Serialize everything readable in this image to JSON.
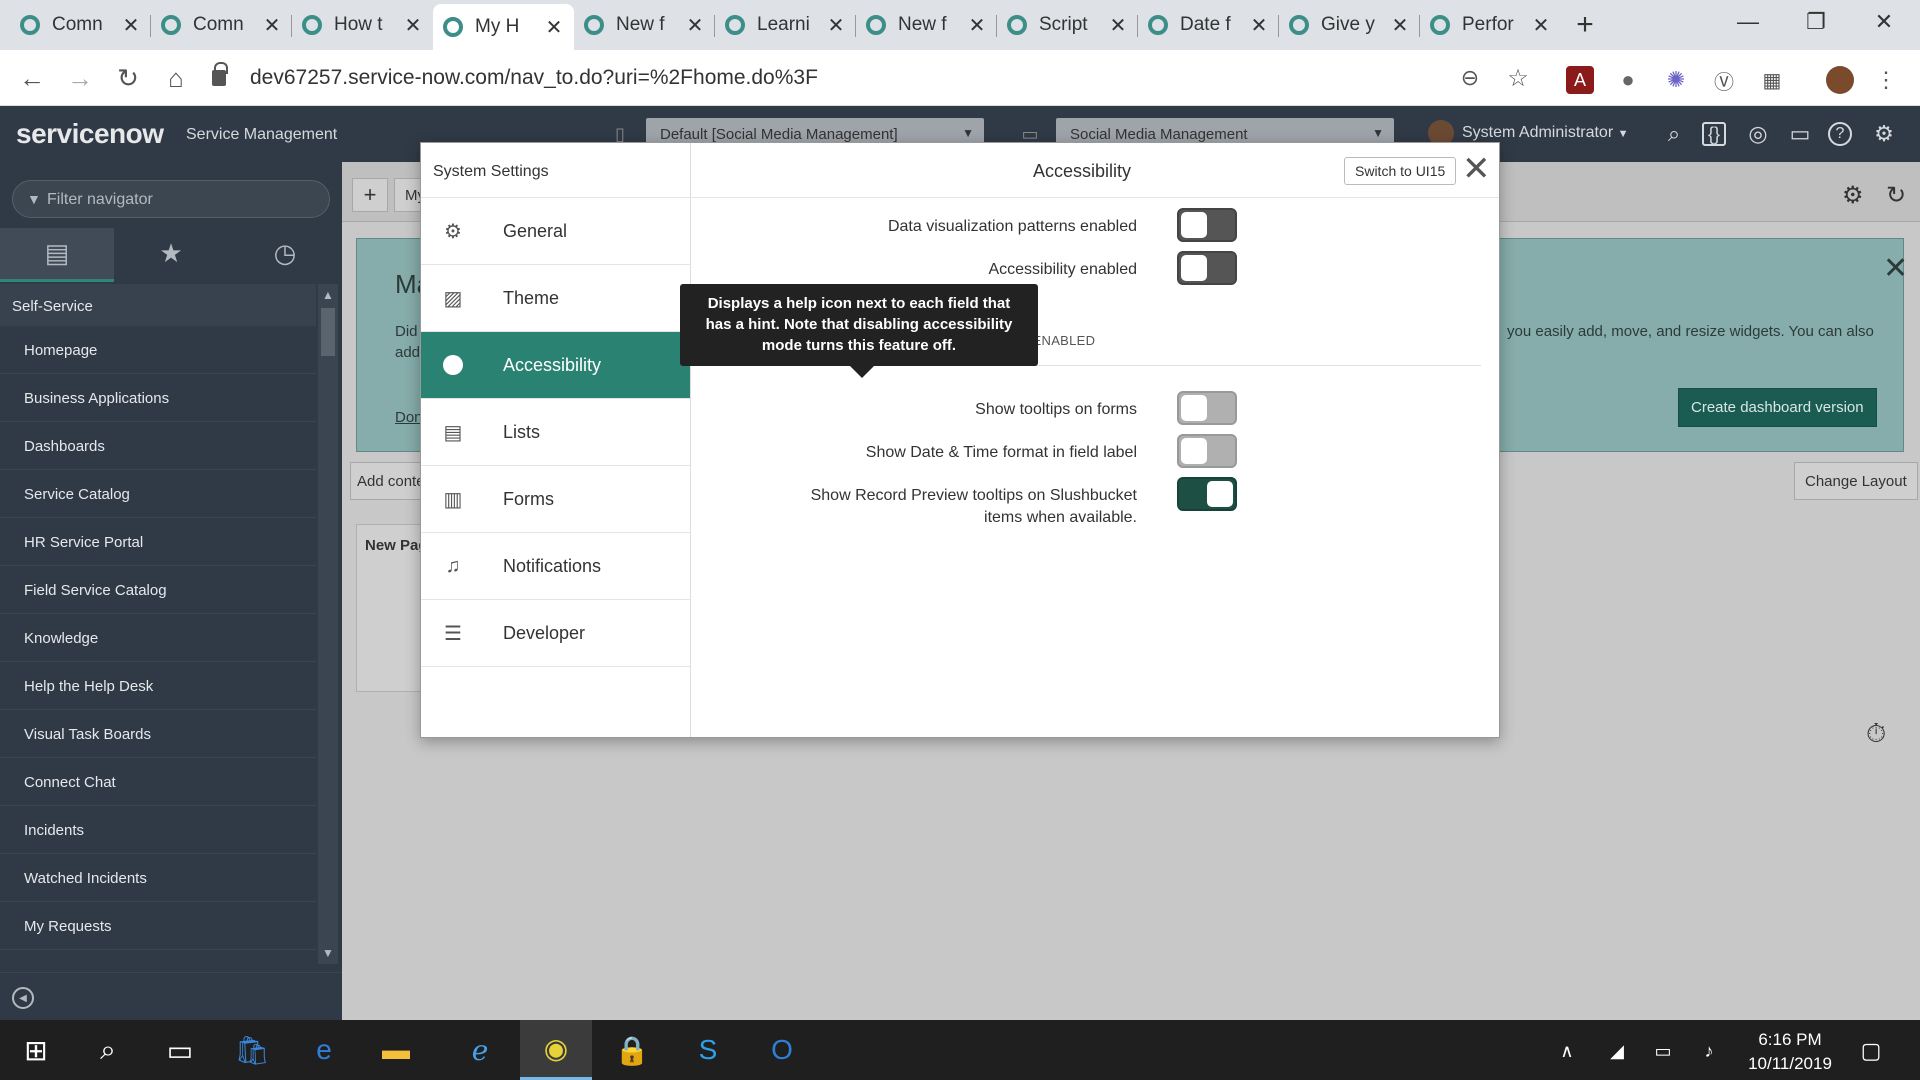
{
  "browser": {
    "tabs": [
      {
        "label": "Comn"
      },
      {
        "label": "Comn"
      },
      {
        "label": "How t"
      },
      {
        "label": "My H",
        "active": true
      },
      {
        "label": "New f"
      },
      {
        "label": "Learni"
      },
      {
        "label": "New f"
      },
      {
        "label": "Script"
      },
      {
        "label": "Date f"
      },
      {
        "label": "Give y"
      },
      {
        "label": "Perfor"
      }
    ],
    "url": "dev67257.service-now.com/nav_to.do?uri=%2Fhome.do%3F"
  },
  "header": {
    "logo": "servicenow",
    "product": "Service Management",
    "update_set": "Default [Social Media Management]",
    "application": "Social Media Management",
    "user": "System Administrator"
  },
  "sidebar": {
    "filter_placeholder": "Filter navigator",
    "section": "Self-Service",
    "items": [
      "Homepage",
      "Business Applications",
      "Dashboards",
      "Service Catalog",
      "HR Service Portal",
      "Field Service Catalog",
      "Knowledge",
      "Help the Help Desk",
      "Visual Task Boards",
      "Connect Chat",
      "Incidents",
      "Watched Incidents",
      "My Requests"
    ]
  },
  "main": {
    "tab_fragment": "My",
    "banner_title": "Ma",
    "banner_text_left": "Did\nadd",
    "banner_text_right": "you easily add, move, and resize widgets. You can also",
    "banner_link": "Don",
    "create_button": "Create dashboard version",
    "add_content": "Add conte",
    "change_layout": "Change Layout",
    "new_page": "New Pag"
  },
  "modal": {
    "left_title": "System Settings",
    "menu": [
      {
        "label": "General",
        "icon": "gear-icon"
      },
      {
        "label": "Theme",
        "icon": "image-icon"
      },
      {
        "label": "Accessibility",
        "icon": "circle-icon",
        "active": true
      },
      {
        "label": "Lists",
        "icon": "list-icon"
      },
      {
        "label": "Forms",
        "icon": "form-icon"
      },
      {
        "label": "Notifications",
        "icon": "bell-icon"
      },
      {
        "label": "Developer",
        "icon": "code-icon"
      }
    ],
    "title": "Accessibility",
    "switch_button": "Switch to UI15",
    "optional_label": "OPTIONAL FEATURES WHEN ACCESSIBILITY IS ENABLED",
    "settings": [
      {
        "label": "Data visualization patterns enabled",
        "state": "off"
      },
      {
        "label": "Accessibility enabled",
        "state": "off"
      },
      {
        "label": "Show tooltips on forms",
        "state": "disabled"
      },
      {
        "label": "Show Date & Time format in field label",
        "state": "disabled"
      },
      {
        "label": "Show Record Preview tooltips on Slushbucket items when available.",
        "state": "on"
      }
    ],
    "tooltip": "Displays a help icon next to each field that has a hint. Note that disabling accessibility mode turns this feature off."
  },
  "taskbar": {
    "time": "6:16 PM",
    "date": "10/11/2019"
  },
  "colors": {
    "accent": "#2a8273",
    "header": "#303a46",
    "toggle_on": "#1d4f45"
  }
}
